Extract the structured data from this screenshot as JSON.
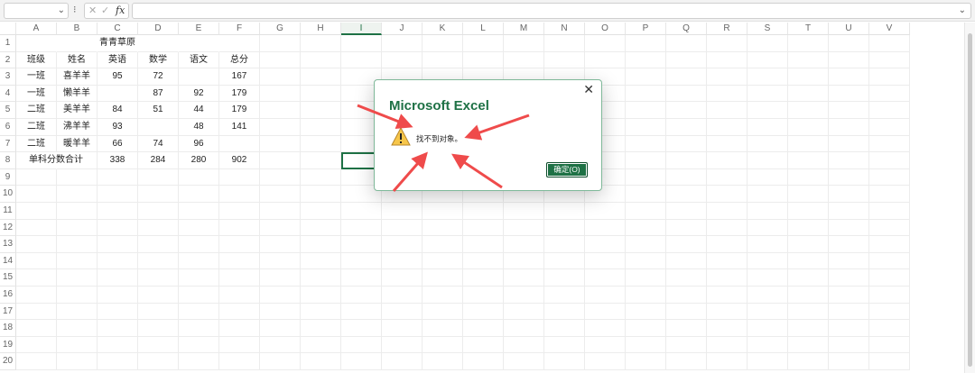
{
  "formula_bar": {
    "name_box": "",
    "cancel_icon": "✕",
    "confirm_icon": "✓",
    "fx_label": "fx",
    "formula": ""
  },
  "columns": [
    "A",
    "B",
    "C",
    "D",
    "E",
    "F",
    "G",
    "H",
    "I",
    "J",
    "K",
    "L",
    "M",
    "N",
    "O",
    "P",
    "Q",
    "R",
    "S",
    "T",
    "U",
    "V"
  ],
  "selected_column": "I",
  "rows": [
    "1",
    "2",
    "3",
    "4",
    "5",
    "6",
    "7",
    "8",
    "9",
    "10",
    "11",
    "12",
    "13",
    "14",
    "15",
    "16",
    "17",
    "18",
    "19",
    "20"
  ],
  "sheet": {
    "title": "青青草原",
    "headers": [
      "班级",
      "姓名",
      "英语",
      "数学",
      "语文",
      "总分"
    ],
    "data": [
      [
        "一班",
        "喜羊羊",
        "95",
        "72",
        "",
        "167"
      ],
      [
        "一班",
        "懒羊羊",
        "",
        "87",
        "92",
        "179"
      ],
      [
        "二班",
        "美羊羊",
        "84",
        "51",
        "44",
        "179"
      ],
      [
        "二班",
        "沸羊羊",
        "93",
        "",
        "48",
        "141"
      ],
      [
        "二班",
        "暖羊羊",
        "66",
        "74",
        "96",
        ""
      ]
    ],
    "total_row": [
      "单科分数合计",
      "338",
      "284",
      "280",
      "902"
    ]
  },
  "dialog": {
    "title": "Microsoft Excel",
    "message": "找不到对象。",
    "ok_label": "确定(O)",
    "close_icon": "✕"
  },
  "colors": {
    "accent": "#1e7145",
    "arrow": "#ef4b4b",
    "warning_fill": "#f7c64a"
  }
}
